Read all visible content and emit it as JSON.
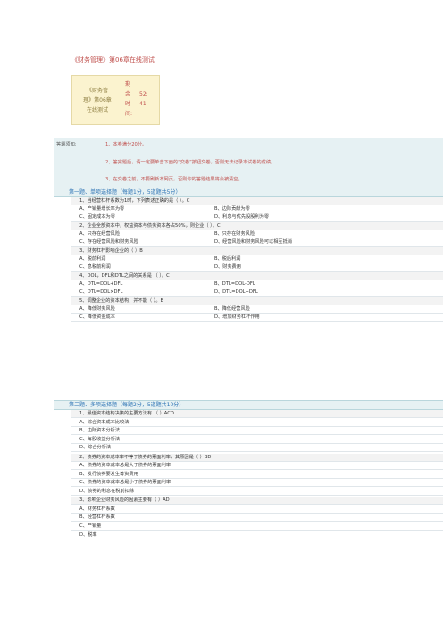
{
  "page_title": "《财务管理》第06章在线测试",
  "info": {
    "name_lines": [
      "《财务管",
      "理》第06章",
      "在线测试"
    ],
    "timer_label": [
      "剩",
      "余",
      "时",
      "间:"
    ],
    "timer_values": [
      "",
      "52:",
      "41",
      ""
    ]
  },
  "notice": {
    "lead": "答题须知:",
    "items": [
      "1、本卷满分20分。",
      "2、答完题后，请一定要单击下面的“交卷”按钮交卷，否则无法记录本试卷的成绩。",
      "3、在交卷之前，不要刷新本网页，否则你的答题结果将会被清空。"
    ]
  },
  "section1": {
    "title": "第一题、单项选择题（每题1分，5道题共5分）",
    "questions": [
      {
        "q": "1、当经营杠杆系数为1时，下列表述正确的是（   ）。C",
        "opts": [
          "A、产销量增长率为零",
          "B、边际贡献为零",
          "C、固定成本为零",
          "D、利息与优先股股利为零"
        ]
      },
      {
        "q": "2、企业全部资本中，权益资本与债务资本各占50%，则企业（ ）。C",
        "opts": [
          "A、只存在经营风险",
          "B、只存在财务风险",
          "C、存在经营风险和财务风险",
          "D、经营风险和财务风险可以相互抵消"
        ]
      },
      {
        "q": "3、财务杠杆影响企业的（ ）B",
        "opts": [
          "A、税前利润",
          "B、税后利润",
          "C、息税前利润",
          "D、财务费用"
        ]
      },
      {
        "q": "4、DOL，DFL和DTL之间的关系是  （ ）。C",
        "opts": [
          "A、DTL=DOL+DFL",
          "B、DTL=DOL-DFL",
          "C、DTL=DOL×DFL",
          "D、DTL=DOL÷DFL"
        ]
      },
      {
        "q": "5、调整企业的资本结构，并不能（ ）。B",
        "opts": [
          "A、降低财务风险",
          "B、降低经营风险",
          "C、降低资金成本",
          "D、增加财务杠杆作用"
        ]
      }
    ]
  },
  "section2": {
    "title": "第二题、多项选择题（每题2分，5道题共10分）",
    "questions": [
      {
        "q": "1、最佳资本结构决策的主要方法有 （ ）ACD",
        "opts": [
          "A、综合资本成本比较法",
          "B、边际资本分析法",
          "C、每股收益分析法",
          "D、综合分析法"
        ]
      },
      {
        "q": "2、债券的资本成本率不等于债券的票面利率，其原因是（ ）BD",
        "opts": [
          "A、债券的资本成本总是大于债券的票面利率",
          "B、发行债券要发生筹资费用",
          "C、债券的资本成本总是小于债券的票面利率",
          "D、债券的利息在税前扣除"
        ]
      },
      {
        "q": "3、影响企业财务风险的因素主要有（ ）AD",
        "opts": [
          "A、财务杠杆系数",
          "B、经营杠杆系数",
          "C、产销量",
          "D、税率"
        ]
      }
    ]
  }
}
